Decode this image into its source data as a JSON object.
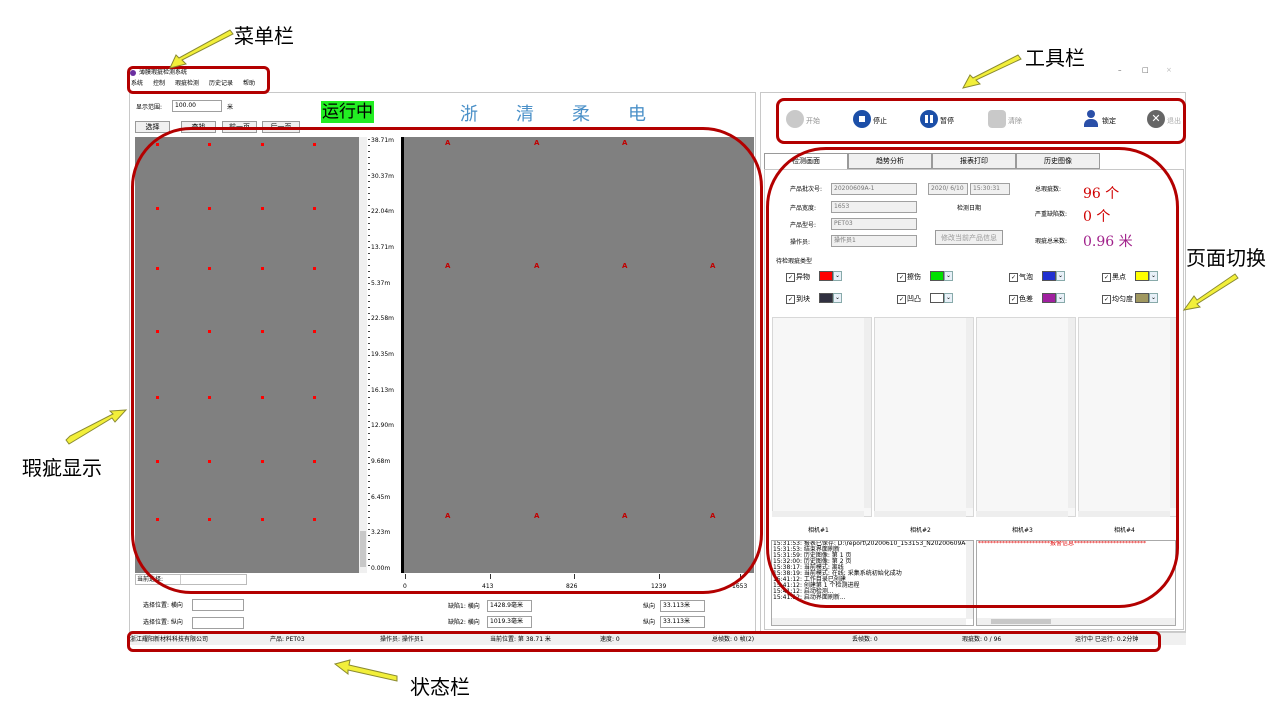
{
  "annotations": {
    "menu_bar": "菜单栏",
    "toolbar": "工具栏",
    "defect_display": "瑕疵显示",
    "page_switch": "页面切换",
    "status_bar": "状态栏"
  },
  "window": {
    "title": "薄膜瑕疵检测系统",
    "controls": {
      "minimize": "–",
      "restore": "□",
      "close": "×"
    }
  },
  "menu": [
    "系统",
    "控制",
    "瑕疵检测",
    "历史记录",
    "帮助"
  ],
  "left": {
    "range_label": "显示范围:",
    "range_value": "100.00",
    "range_unit": "米",
    "buttons": {
      "select": "选择",
      "query": "查找",
      "prev": "前一页",
      "next": "后一页"
    },
    "running": "运行中",
    "company_chars": [
      "浙",
      "清",
      "柔",
      "电"
    ],
    "scale_labels": [
      "38.71m",
      "30.37m",
      "22.04m",
      "13.71m",
      "5.37m",
      "22.58m",
      "19.35m",
      "16.13m",
      "12.90m",
      "9.68m",
      "6.45m",
      "3.23m",
      "0.00m"
    ],
    "x_ticks": [
      "0",
      "413",
      "826",
      "1239",
      "1653"
    ],
    "current_select_label": "当前选择:",
    "select_pos_h": "选择位置: 横向",
    "select_pos_v": "选择位置: 纵向",
    "defect1_label": "缺陷1: 横向",
    "defect1_value": "1428.9毫米",
    "defect2_label": "缺陷2: 横向",
    "defect2_value": "1019.3毫米",
    "long_label1": "纵向",
    "long_value1": "33.113米",
    "long_label2": "纵向",
    "long_value2": "33.113米"
  },
  "toolbar": {
    "start": "开始",
    "stop": "停止",
    "pause": "暂停",
    "clear": "清除",
    "lock": "锁定",
    "exit": "退出"
  },
  "tabs": [
    "检测画面",
    "趋势分析",
    "报表打印",
    "历史图像"
  ],
  "info": {
    "batch_label": "产品批次号:",
    "batch_value": "20200609A-1",
    "width_label": "产品宽度:",
    "width_value": "1653",
    "model_label": "产品型号:",
    "model_value": "PET03",
    "operator_label": "操作员:",
    "operator_value": "操作员1",
    "date_value": "2020/ 6/10",
    "time_value": "15:30:31",
    "detect_date_label": "检测日期",
    "modify_button": "修改当前产品信息",
    "total_defects_label": "总瑕疵数:",
    "total_defects_value": "96 个",
    "serious_defects_label": "严重缺陷数:",
    "serious_defects_value": "0 个",
    "total_meters_label": "瑕疵总米数:",
    "total_meters_value": "0.96 米"
  },
  "defect_types": {
    "title": "待检瑕疵类型",
    "items": [
      {
        "label": "异物",
        "color": "#ff0000"
      },
      {
        "label": "擦伤",
        "color": "#00e000"
      },
      {
        "label": "气泡",
        "color": "#2030d0"
      },
      {
        "label": "黑点",
        "color": "#ffff00"
      },
      {
        "label": "到块",
        "color": "#303040"
      },
      {
        "label": "凹凸",
        "color": "#ffffff"
      },
      {
        "label": "色差",
        "color": "#a020a0"
      },
      {
        "label": "均匀度",
        "color": "#a09860"
      }
    ]
  },
  "cameras": [
    "相机#1",
    "相机#2",
    "相机#3",
    "相机#4"
  ],
  "log_lines": [
    "15:31:53: 报表已保存: D:\\report\\20200610_153153_N20200609A-1_]",
    "15:31:53: 结束界面刷新",
    "15:31:59: 历史图像: 第 1 页",
    "15:32:00: 历史图像: 第 2 页",
    "15:38:17: 当前模式: 离线",
    "15:38:19: 当前模式: 在线; 采集系统初始化成功",
    "15:41:12: 工作目录已创建",
    "15:41:12: 创建第 1 个检测进程",
    "15:41:12: 启动检测...",
    "15:41:12: 启动界面刷新..."
  ],
  "alarm_title": "************************报警信息************************",
  "status_bar": {
    "company": "浙江耀阳新材料科技有限公司",
    "product": "产品:  PET03",
    "operator": "操作员:  操作员1",
    "position": "当前位置:  第 38.71 米",
    "speed": "速度:  0",
    "total_frames": "总帧数:  0 帧(2)",
    "lost_frames": "丢帧数:  0",
    "defects": "瑕疵数:  0 / 96",
    "running": "运行中  已运行:  0.2分钟"
  }
}
